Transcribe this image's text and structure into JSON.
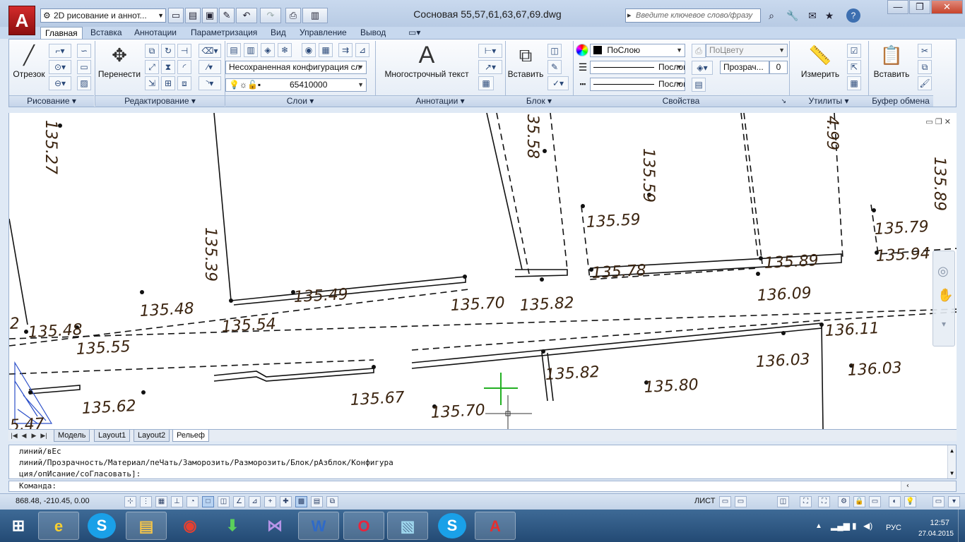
{
  "window": {
    "workspace": "2D рисование и аннот...",
    "doc_title": "Сосновая 55,57,61,63,67,69.dwg",
    "search_placeholder": "Введите ключевое слово/фразу",
    "app_logo": "A"
  },
  "tabs": [
    "Главная",
    "Вставка",
    "Аннотации",
    "Параметризация",
    "Вид",
    "Управление",
    "Вывод"
  ],
  "ribbon": {
    "draw": {
      "title": "Рисование",
      "line_label": "Отрезок"
    },
    "modify": {
      "title": "Редактирование",
      "move_label": "Перенести"
    },
    "layers": {
      "title": "Слои",
      "layer_state": "Несохраненная конфигурация сл",
      "current_layer": "65410000"
    },
    "annotation": {
      "title": "Аннотации",
      "mtext_label": "Многострочный текст"
    },
    "block": {
      "title": "Блок",
      "insert_label": "Вставить"
    },
    "properties": {
      "title": "Свойства",
      "color": "ПоСлою",
      "plotstyle": "ПоЦвету",
      "lineweight": "Послою",
      "linetype": "Послою",
      "transparency_label": "Прозрач...",
      "transparency": "0"
    },
    "utilities": {
      "title": "Утилиты",
      "measure_label": "Измерить"
    },
    "clipboard": {
      "title": "Буфер обмена",
      "paste_label": "Вставить"
    }
  },
  "drawing": {
    "labels": [
      {
        "text": "135.27",
        "rotate": 90
      },
      {
        "text": "135.39",
        "rotate": 90
      },
      {
        "text": "35.58",
        "rotate": 90
      },
      {
        "text": "135.59",
        "rotate": 90
      },
      {
        "text": "4.99",
        "rotate": 90
      },
      {
        "text": "135.89",
        "rotate": 90
      },
      {
        "text": "135.59",
        "rotate": 0
      },
      {
        "text": "135.79",
        "rotate": 0
      },
      {
        "text": "135.94",
        "rotate": 0
      },
      {
        "text": "135.78",
        "rotate": 0
      },
      {
        "text": "135.89",
        "rotate": 0
      },
      {
        "text": "136.09",
        "rotate": 0
      },
      {
        "text": "135.49",
        "rotate": 0
      },
      {
        "text": "135.70",
        "rotate": 0
      },
      {
        "text": "135.82",
        "rotate": 0
      },
      {
        "text": "135.48",
        "rotate": 0
      },
      {
        "text": "135.48",
        "rotate": 0
      },
      {
        "text": "135.54",
        "rotate": 0
      },
      {
        "text": "135.55",
        "rotate": 0
      },
      {
        "text": "136.11",
        "rotate": 0
      },
      {
        "text": "136.03",
        "rotate": 0
      },
      {
        "text": "136.03",
        "rotate": 0
      },
      {
        "text": "135.82",
        "rotate": 0
      },
      {
        "text": "135.80",
        "rotate": 0
      },
      {
        "text": "135.67",
        "rotate": 0
      },
      {
        "text": "135.70",
        "rotate": 0
      },
      {
        "text": "135.62",
        "rotate": 0
      },
      {
        "text": "5.47",
        "rotate": 0
      },
      {
        "text": "2",
        "rotate": 0
      }
    ]
  },
  "layout_tabs": [
    "Модель",
    "Layout1",
    "Layout2",
    "Рельеф"
  ],
  "active_layout": "Рельеф",
  "command": {
    "history": [
      "линий/вЕс",
      "линий/Прозрачность/Материал/пеЧать/Заморозить/Разморозить/Блок/рАзблок/Конфигура",
      "ция/опИсание/соГласовать]:"
    ],
    "prompt": "Команда:"
  },
  "status": {
    "coords": "868.48, -210.45, 0.00",
    "layout_mode": "ЛИСТ"
  },
  "taskbar": {
    "apps": [
      "windows-start",
      "internet-explorer",
      "skype",
      "file-explorer",
      "chrome",
      "download-manager",
      "visual-studio",
      "word",
      "opera",
      "photo-viewer",
      "skype-2",
      "autocad"
    ],
    "lang": "РУС",
    "time": "12:57",
    "date": "27.04.2015"
  }
}
